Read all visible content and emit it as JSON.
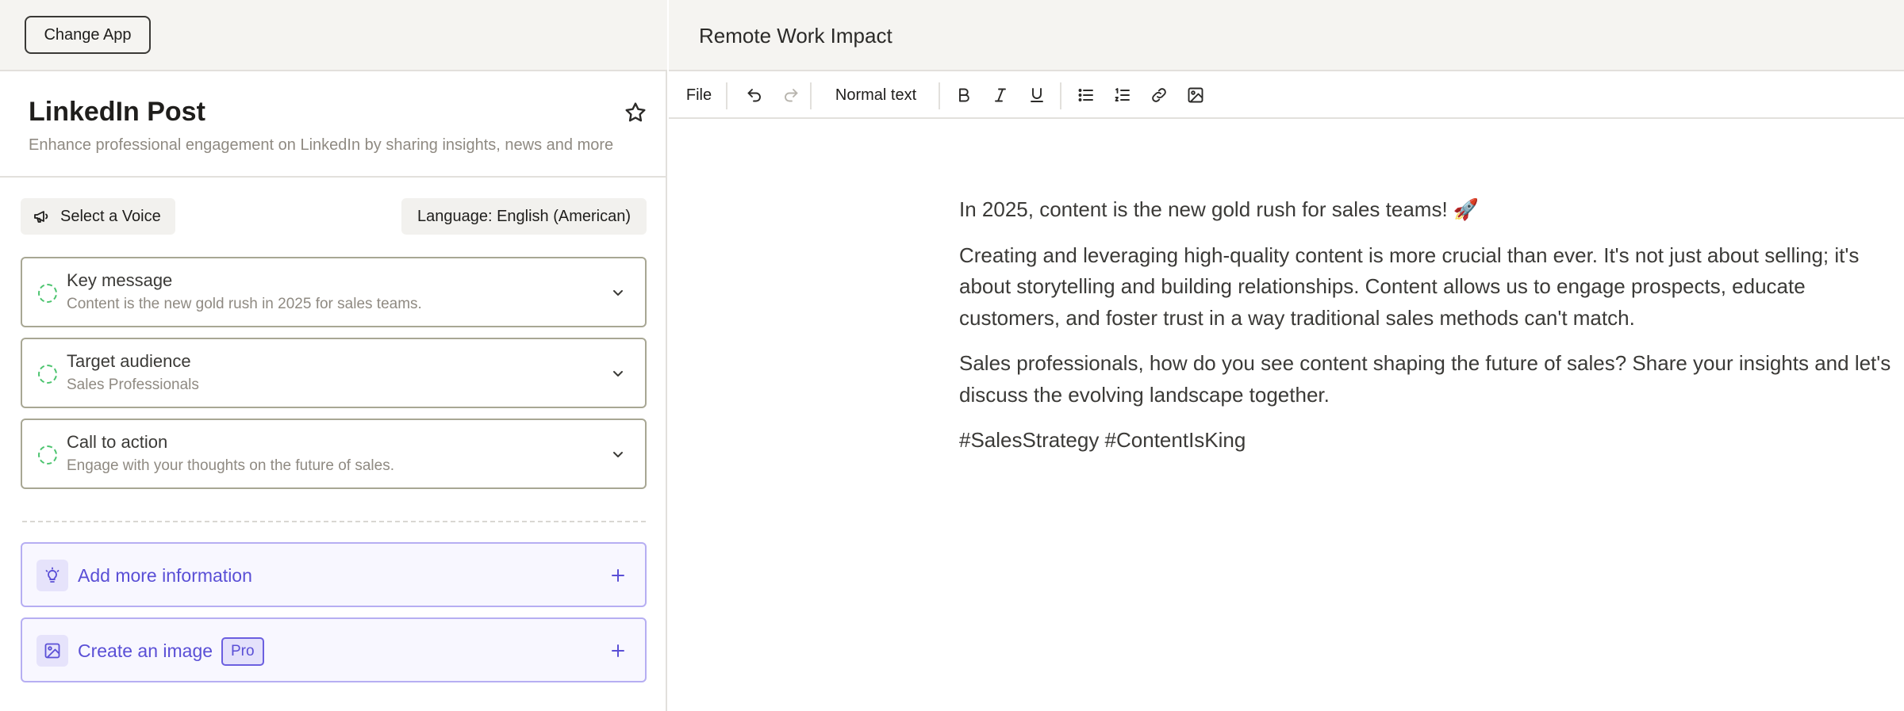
{
  "left": {
    "change_app_label": "Change App",
    "tool": {
      "title": "LinkedIn Post",
      "subtitle": "Enhance professional engagement on LinkedIn by sharing insights, news and more"
    },
    "voice_label": "Select a Voice",
    "language_label": "Language: English (American)",
    "accordions": [
      {
        "label": "Key message",
        "value": "Content is the new gold rush in 2025 for sales teams."
      },
      {
        "label": "Target audience",
        "value": "Sales Professionals"
      },
      {
        "label": "Call to action",
        "value": "Engage with your thoughts on the future of sales."
      }
    ],
    "add_more_label": "Add more information",
    "create_image_label": "Create an image",
    "pro_badge": "Pro"
  },
  "document": {
    "title": "Remote Work Impact",
    "toolbar": {
      "file_label": "File",
      "text_style": "Normal text"
    },
    "paragraphs": [
      "In 2025, content is the new gold rush for sales teams! 🚀",
      "Creating and leveraging high-quality content is more crucial than ever. It's not just about selling; it's about storytelling and building relationships. Content allows us to engage prospects, educate customers, and foster trust in a way traditional sales methods can't match.",
      "Sales professionals, how do you see content shaping the future of sales? Share your insights and let's discuss the evolving landscape together.",
      "#SalesStrategy #ContentIsKing"
    ]
  },
  "colors": {
    "accent": "#5a4fd6",
    "accent_border": "#b6aef2",
    "status_dot": "#4cc46f"
  }
}
